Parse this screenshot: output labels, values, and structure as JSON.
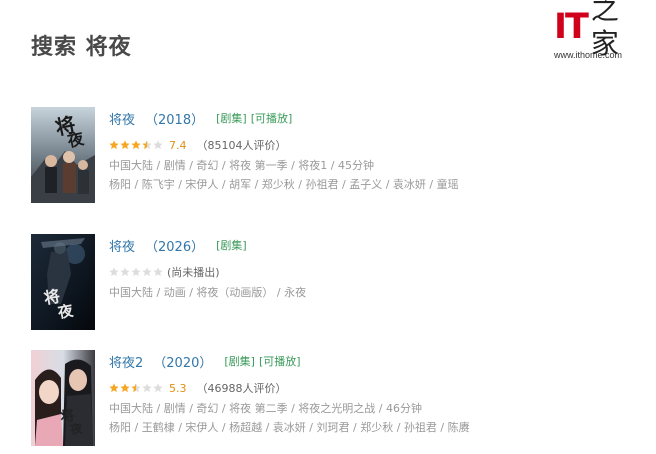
{
  "page": {
    "title": "搜索 将夜"
  },
  "watermark": {
    "logo_it": "IT",
    "logo_zh": "之家",
    "url": "www.ithome.com"
  },
  "colors": {
    "link": "#3377aa",
    "tag": "#3a9b5a",
    "star": "#f5a623",
    "score": "#e09015",
    "meta": "#999999"
  },
  "results": [
    {
      "title": "将夜",
      "year": "（2018）",
      "tags": [
        "[剧集]",
        "[可播放]"
      ],
      "stars": 3.5,
      "score": "7.4",
      "votes": "（85104人评价）",
      "abstract": "中国大陆 / 剧情 / 奇幻 / 将夜 第一季 / 将夜1 / 45分钟",
      "abstract_2": "杨阳 / 陈飞宇 / 宋伊人 / 胡军 / 郑少秋 / 孙祖君 / 孟子义 / 袁冰妍 / 童瑶"
    },
    {
      "title": "将夜",
      "year": "（2026）",
      "tags": [
        "[剧集]"
      ],
      "stars": 0,
      "status": "(尚未播出)",
      "abstract": "中国大陆 / 动画 / 将夜（动画版） / 永夜"
    },
    {
      "title": "将夜2",
      "year": "（2020）",
      "tags": [
        "[剧集]",
        "[可播放]"
      ],
      "stars": 2.5,
      "score": "5.3",
      "votes": "（46988人评价）",
      "abstract": "中国大陆 / 剧情 / 奇幻 / 将夜 第二季 / 将夜之光明之战 / 46分钟",
      "abstract_2": "杨阳 / 王鹤棣 / 宋伊人 / 杨超越 / 袁冰妍 / 刘珂君 / 郑少秋 / 孙祖君 / 陈赓"
    }
  ]
}
